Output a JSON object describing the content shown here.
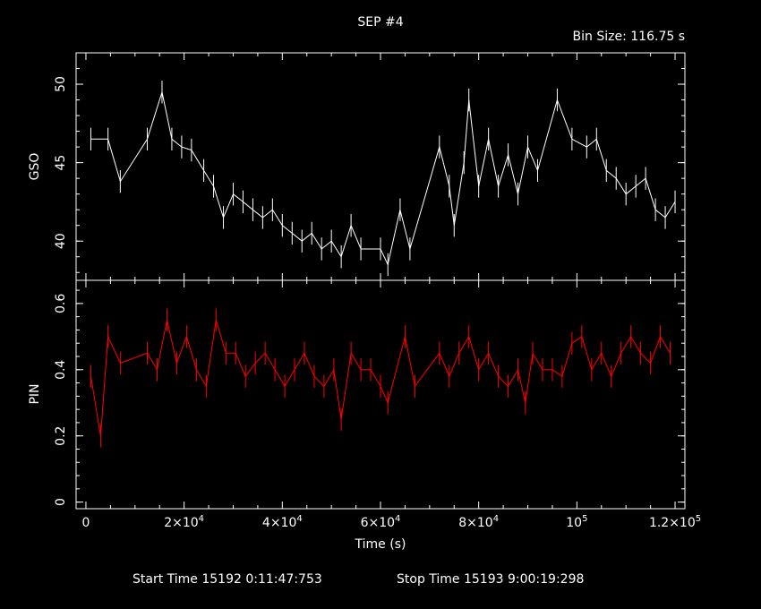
{
  "title": "SEP #4",
  "bin_size_label": "Bin Size:  116.75  s",
  "footer": {
    "start": "Start Time 15192  0:11:47:753",
    "stop": "Stop Time 15193  9:00:19:298"
  },
  "colors": {
    "background": "#000000",
    "axes": "#ffffff",
    "gso_series": "#ffffff",
    "pin_series": "#ff0000"
  },
  "chart_data": [
    {
      "type": "line",
      "panel": "top",
      "ylabel": "GSO",
      "xlim": [
        -2000,
        122000
      ],
      "ylim": [
        37.5,
        52
      ],
      "yticks": [
        40,
        45,
        50
      ],
      "ytick_labels": [
        "40",
        "45",
        "50"
      ],
      "series": [
        {
          "color": "#ffffff",
          "points": [
            [
              1000,
              46.5
            ],
            [
              4500,
              46.5
            ],
            [
              7000,
              43.8
            ],
            [
              12500,
              46.5
            ],
            [
              15500,
              49.5
            ],
            [
              17500,
              46.5
            ],
            [
              19500,
              46
            ],
            [
              21500,
              45.8
            ],
            [
              24000,
              44.5
            ],
            [
              26000,
              43.5
            ],
            [
              28000,
              41.5
            ],
            [
              30000,
              43
            ],
            [
              32000,
              42.5
            ],
            [
              34000,
              42
            ],
            [
              36000,
              41.5
            ],
            [
              38000,
              42
            ],
            [
              40000,
              41
            ],
            [
              42000,
              40.5
            ],
            [
              44000,
              40
            ],
            [
              46000,
              40.5
            ],
            [
              48000,
              39.5
            ],
            [
              50000,
              40
            ],
            [
              52000,
              39
            ],
            [
              54000,
              41
            ],
            [
              56000,
              39.5
            ],
            [
              60000,
              39.5
            ],
            [
              61500,
              38.5
            ],
            [
              64000,
              42
            ],
            [
              66000,
              39.5
            ],
            [
              72000,
              46
            ],
            [
              74000,
              43.5
            ],
            [
              75000,
              41
            ],
            [
              77000,
              45
            ],
            [
              78000,
              49
            ],
            [
              80000,
              43.5
            ],
            [
              82000,
              46.5
            ],
            [
              84000,
              43.5
            ],
            [
              86000,
              45.5
            ],
            [
              88000,
              43
            ],
            [
              90000,
              46
            ],
            [
              92000,
              44.5
            ],
            [
              96000,
              49
            ],
            [
              99000,
              46.5
            ],
            [
              102000,
              46
            ],
            [
              104000,
              46.5
            ],
            [
              106000,
              44.5
            ],
            [
              108000,
              44
            ],
            [
              110000,
              43
            ],
            [
              112000,
              43.5
            ],
            [
              114000,
              44
            ],
            [
              116000,
              42
            ],
            [
              118000,
              41.5
            ],
            [
              120000,
              42.5
            ]
          ]
        }
      ]
    },
    {
      "type": "line",
      "panel": "bottom",
      "ylabel": "PIN",
      "xlabel": "Time (s)",
      "xlim": [
        -2000,
        122000
      ],
      "ylim": [
        -0.02,
        0.67
      ],
      "yticks": [
        0,
        0.2,
        0.4,
        0.6
      ],
      "ytick_labels": [
        "0",
        "0.2",
        "0.4",
        "0.6"
      ],
      "xticks": [
        0,
        20000,
        40000,
        60000,
        80000,
        100000,
        120000
      ],
      "xtick_labels": [
        {
          "mant": "0",
          "exp": ""
        },
        {
          "mant": "2×10",
          "exp": "4"
        },
        {
          "mant": "4×10",
          "exp": "4"
        },
        {
          "mant": "6×10",
          "exp": "4"
        },
        {
          "mant": "8×10",
          "exp": "4"
        },
        {
          "mant": "10",
          "exp": "5"
        },
        {
          "mant": "1.2×10",
          "exp": "5"
        }
      ],
      "series": [
        {
          "color": "#ff0000",
          "points": [
            [
              1000,
              0.38
            ],
            [
              3000,
              0.2
            ],
            [
              4500,
              0.5
            ],
            [
              7000,
              0.42
            ],
            [
              12500,
              0.45
            ],
            [
              14500,
              0.4
            ],
            [
              16500,
              0.55
            ],
            [
              18500,
              0.42
            ],
            [
              20500,
              0.5
            ],
            [
              22500,
              0.4
            ],
            [
              24500,
              0.35
            ],
            [
              26500,
              0.55
            ],
            [
              28500,
              0.45
            ],
            [
              30500,
              0.45
            ],
            [
              32500,
              0.38
            ],
            [
              34500,
              0.42
            ],
            [
              36500,
              0.45
            ],
            [
              38500,
              0.4
            ],
            [
              40500,
              0.35
            ],
            [
              42500,
              0.4
            ],
            [
              44500,
              0.45
            ],
            [
              46500,
              0.38
            ],
            [
              48500,
              0.35
            ],
            [
              50500,
              0.4
            ],
            [
              52000,
              0.25
            ],
            [
              54000,
              0.45
            ],
            [
              56000,
              0.4
            ],
            [
              58000,
              0.4
            ],
            [
              60000,
              0.35
            ],
            [
              61500,
              0.3
            ],
            [
              65000,
              0.5
            ],
            [
              67000,
              0.35
            ],
            [
              72000,
              0.45
            ],
            [
              74000,
              0.38
            ],
            [
              76000,
              0.45
            ],
            [
              78000,
              0.5
            ],
            [
              80000,
              0.4
            ],
            [
              82000,
              0.45
            ],
            [
              84000,
              0.38
            ],
            [
              86000,
              0.35
            ],
            [
              88000,
              0.4
            ],
            [
              89500,
              0.3
            ],
            [
              91000,
              0.45
            ],
            [
              93000,
              0.4
            ],
            [
              95000,
              0.4
            ],
            [
              97000,
              0.38
            ],
            [
              99000,
              0.48
            ],
            [
              101000,
              0.5
            ],
            [
              103000,
              0.4
            ],
            [
              105000,
              0.45
            ],
            [
              107000,
              0.38
            ],
            [
              109000,
              0.45
            ],
            [
              111000,
              0.5
            ],
            [
              113000,
              0.45
            ],
            [
              115000,
              0.42
            ],
            [
              117000,
              0.5
            ],
            [
              119000,
              0.45
            ]
          ]
        }
      ]
    }
  ]
}
